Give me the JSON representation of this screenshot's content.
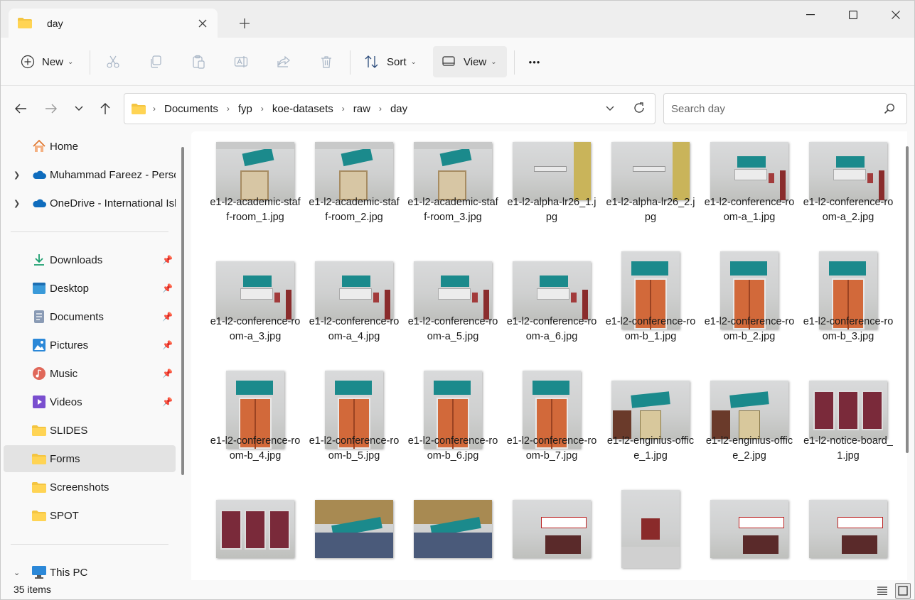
{
  "tab": {
    "title": "day",
    "close_icon": "close-icon",
    "new_tab_label": "+"
  },
  "toolbar": {
    "new_label": "New",
    "sort_label": "Sort",
    "view_label": "View",
    "more_label": "•••"
  },
  "address": {
    "crumbs": [
      "Documents",
      "fyp",
      "koe-datasets",
      "raw",
      "day"
    ]
  },
  "search": {
    "placeholder": "Search day"
  },
  "sidebar": {
    "items": [
      {
        "label": "Home",
        "icon": "home-icon"
      },
      {
        "label": "Muhammad Fareez - Personal",
        "icon": "cloud-icon"
      },
      {
        "label": "OneDrive - International Islamic University Malaysia",
        "icon": "cloud-icon"
      },
      {
        "label": "Downloads",
        "icon": "download-icon"
      },
      {
        "label": "Desktop",
        "icon": "desktop-icon"
      },
      {
        "label": "Documents",
        "icon": "document-icon"
      },
      {
        "label": "Pictures",
        "icon": "pictures-icon"
      },
      {
        "label": "Music",
        "icon": "music-icon"
      },
      {
        "label": "Videos",
        "icon": "video-icon"
      },
      {
        "label": "SLIDES",
        "icon": "folder-icon"
      },
      {
        "label": "Forms",
        "icon": "folder-icon"
      },
      {
        "label": "Screenshots",
        "icon": "folder-icon"
      },
      {
        "label": "SPOT",
        "icon": "folder-icon"
      },
      {
        "label": "This PC",
        "icon": "computer-icon"
      }
    ]
  },
  "files": [
    {
      "name": "e1-l2-academic-staff-room_1.jpg",
      "orient": "l",
      "kind": "door"
    },
    {
      "name": "e1-l2-academic-staff-room_2.jpg",
      "orient": "l",
      "kind": "door"
    },
    {
      "name": "e1-l2-academic-staff-room_3.jpg",
      "orient": "l",
      "kind": "door"
    },
    {
      "name": "e1-l2-alpha-lr26_1.jpg",
      "orient": "l",
      "kind": "wall"
    },
    {
      "name": "e1-l2-alpha-lr26_2.jpg",
      "orient": "l",
      "kind": "wall"
    },
    {
      "name": "e1-l2-conference-room-a_1.jpg",
      "orient": "l",
      "kind": "sign"
    },
    {
      "name": "e1-l2-conference-room-a_2.jpg",
      "orient": "l",
      "kind": "sign"
    },
    {
      "name": "e1-l2-conference-room-a_3.jpg",
      "orient": "l",
      "kind": "sign"
    },
    {
      "name": "e1-l2-conference-room-a_4.jpg",
      "orient": "l",
      "kind": "sign"
    },
    {
      "name": "e1-l2-conference-room-a_5.jpg",
      "orient": "l",
      "kind": "sign"
    },
    {
      "name": "e1-l2-conference-room-a_6.jpg",
      "orient": "l",
      "kind": "sign"
    },
    {
      "name": "e1-l2-conference-room-b_1.jpg",
      "orient": "p",
      "kind": "orange"
    },
    {
      "name": "e1-l2-conference-room-b_2.jpg",
      "orient": "p",
      "kind": "orange"
    },
    {
      "name": "e1-l2-conference-room-b_3.jpg",
      "orient": "p",
      "kind": "orange"
    },
    {
      "name": "e1-l2-conference-room-b_4.jpg",
      "orient": "p",
      "kind": "orange"
    },
    {
      "name": "e1-l2-conference-room-b_5.jpg",
      "orient": "p",
      "kind": "orange"
    },
    {
      "name": "e1-l2-conference-room-b_6.jpg",
      "orient": "p",
      "kind": "orange"
    },
    {
      "name": "e1-l2-conference-room-b_7.jpg",
      "orient": "p",
      "kind": "orange"
    },
    {
      "name": "e1-l2-enginius-office_1.jpg",
      "orient": "l",
      "kind": "office"
    },
    {
      "name": "e1-l2-enginius-office_2.jpg",
      "orient": "l",
      "kind": "office"
    },
    {
      "name": "e1-l2-notice-board_1.jpg",
      "orient": "l",
      "kind": "board"
    },
    {
      "name": "",
      "orient": "l",
      "kind": "board"
    },
    {
      "name": "",
      "orient": "l",
      "kind": "corridor"
    },
    {
      "name": "",
      "orient": "l",
      "kind": "corridor"
    },
    {
      "name": "",
      "orient": "l",
      "kind": "banner"
    },
    {
      "name": "",
      "orient": "p",
      "kind": "hall"
    },
    {
      "name": "",
      "orient": "l",
      "kind": "banner"
    },
    {
      "name": "",
      "orient": "l",
      "kind": "banner"
    }
  ],
  "status": {
    "count": "35 items"
  },
  "colors": {
    "accent": "#0067c0",
    "folder": "#f4c542",
    "sign": "#1b8a8c",
    "door_orange": "#d2693a"
  }
}
